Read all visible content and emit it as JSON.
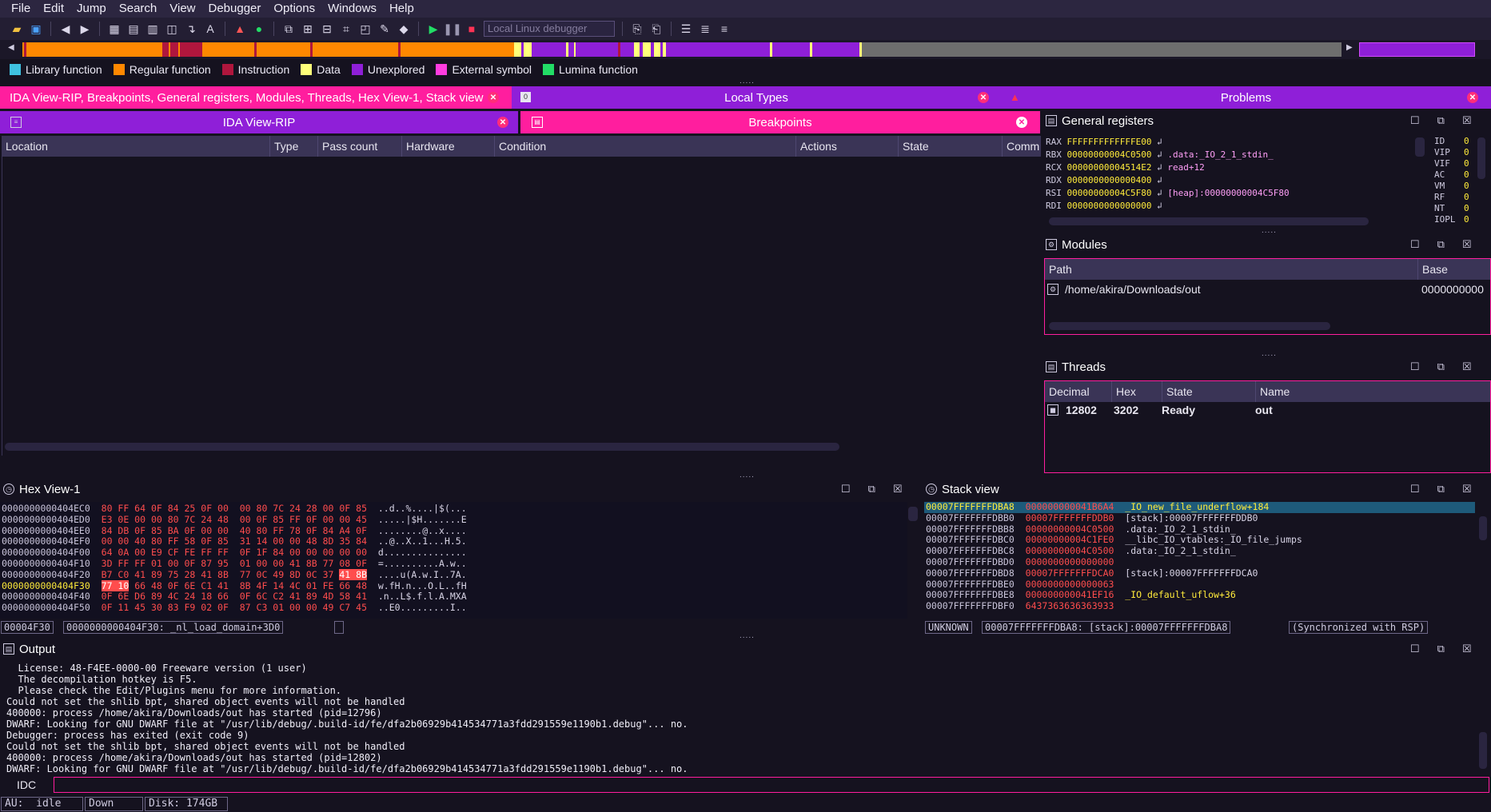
{
  "menu": [
    "File",
    "Edit",
    "Jump",
    "Search",
    "View",
    "Debugger",
    "Options",
    "Windows",
    "Help"
  ],
  "toolbar": {
    "debugger_select": "Local Linux debugger"
  },
  "legend": [
    {
      "label": "Library function",
      "color": "#3fc1e0"
    },
    {
      "label": "Regular function",
      "color": "#ff8800"
    },
    {
      "label": "Instruction",
      "color": "#b0163d"
    },
    {
      "label": "Data",
      "color": "#ffff7a"
    },
    {
      "label": "Unexplored",
      "color": "#8f1fd8"
    },
    {
      "label": "External symbol",
      "color": "#ff3ce0"
    },
    {
      "label": "Lumina function",
      "color": "#22dd66"
    }
  ],
  "top_tabs": {
    "main": "IDA View-RIP, Breakpoints, General registers, Modules, Threads, Hex View-1, Stack view",
    "local_types": "Local Types",
    "problems": "Problems"
  },
  "sub_tabs": {
    "ida_view": "IDA View-RIP",
    "breakpoints": "Breakpoints"
  },
  "breakpoints": {
    "columns": [
      "Location",
      "Type",
      "Pass count",
      "Hardware",
      "Condition",
      "Actions",
      "State",
      "Comm"
    ]
  },
  "general_registers": {
    "title": "General registers",
    "rows": [
      {
        "name": "RAX",
        "value": "FFFFFFFFFFFFFE00",
        "comment": ""
      },
      {
        "name": "RBX",
        "value": "00000000004C0500",
        "comment": ".data:_IO_2_1_stdin_"
      },
      {
        "name": "RCX",
        "value": "00000000004514E2",
        "comment": "read+12"
      },
      {
        "name": "RDX",
        "value": "0000000000000400",
        "comment": ""
      },
      {
        "name": "RSI",
        "value": "00000000004C5F80",
        "comment": "[heap]:00000000004C5F80"
      },
      {
        "name": "RDI",
        "value": "0000000000000000",
        "comment": ""
      }
    ],
    "flags": [
      {
        "name": "ID",
        "value": "0"
      },
      {
        "name": "VIP",
        "value": "0"
      },
      {
        "name": "VIF",
        "value": "0"
      },
      {
        "name": "AC",
        "value": "0"
      },
      {
        "name": "VM",
        "value": "0"
      },
      {
        "name": "RF",
        "value": "0"
      },
      {
        "name": "NT",
        "value": "0"
      },
      {
        "name": "IOPL",
        "value": "0"
      }
    ]
  },
  "modules": {
    "title": "Modules",
    "columns": [
      "Path",
      "Base"
    ],
    "rows": [
      {
        "path": "/home/akira/Downloads/out",
        "base": "0000000000"
      }
    ]
  },
  "threads": {
    "title": "Threads",
    "columns": [
      "Decimal",
      "Hex",
      "State",
      "Name"
    ],
    "rows": [
      {
        "decimal": "12802",
        "hex": "3202",
        "state": "Ready",
        "name": "out"
      }
    ]
  },
  "hex_view": {
    "title": "Hex View-1",
    "rows": [
      {
        "addr": "0000000000404EC0",
        "b1": "80 FF 64 0F 84 25 0F 00",
        "b2": "00 80 7C 24 28 00 0F 85",
        "ascii": "..d..%....|$(..."
      },
      {
        "addr": "0000000000404ED0",
        "b1": "E3 0E 00 00 80 7C 24 48",
        "b2": "00 0F 85 FF 0F 00 00 45",
        "ascii": ".....|$H.......E"
      },
      {
        "addr": "0000000000404EE0",
        "b1": "84 DB 0F 85 BA 0F 00 00",
        "b2": "40 80 FF 78 0F 84 A4 0F",
        "ascii": "........@..x...."
      },
      {
        "addr": "0000000000404EF0",
        "b1": "00 00 40 80 FF 58 0F 85",
        "b2": "31 14 00 00 48 8D 35 84",
        "ascii": "..@..X..1...H.5."
      },
      {
        "addr": "0000000000404F00",
        "b1": "64 0A 00 E9 CF FE FF FF",
        "b2": "0F 1F 84 00 00 00 00 00",
        "ascii": "d..............."
      },
      {
        "addr": "0000000000404F10",
        "b1": "3D FF FF 01 00 0F 87 95",
        "b2": "01 00 00 41 8B 77 08 0F",
        "ascii": "=..........A.w.."
      },
      {
        "addr": "0000000000404F20",
        "b1": "B7 C0 41 89 75 28 41 8B",
        "b2": "77 0C 49 8D 0C 37 41 8B",
        "ascii": "....u(A.w.I..7A."
      },
      {
        "addr": "0000000000404F30",
        "b1": "77 10 66 48 0F 6E C1 41",
        "b2": "8B 4F 14 4C 01 FE 66 48",
        "ascii": "w.fH.n...O.L..fH"
      },
      {
        "addr": "0000000000404F40",
        "b1": "0F 6E D6 89 4C 24 18 66",
        "b2": "0F 6C C2 41 89 4D 58 41",
        "ascii": ".n..L$.f.l.A.MXA"
      },
      {
        "addr": "0000000000404F50",
        "b1": "0F 11 45 30 83 F9 02 0F",
        "b2": "87 C3 01 00 00 49 C7 45",
        "ascii": "..E0.........I.."
      }
    ],
    "status_offset": "00004F30",
    "status_location": "0000000000404F30: _nl_load_domain+3D0"
  },
  "stack_view": {
    "title": "Stack view",
    "rows": [
      {
        "addr": "00007FFFFFFFDBA8",
        "val": "000000000041B6A4",
        "cmt": "_IO_new_file_underflow+184",
        "type": "sym"
      },
      {
        "addr": "00007FFFFFFFDBB0",
        "val": "00007FFFFFFFDDB0",
        "cmt": "[stack]:00007FFFFFFFDDB0",
        "type": "plain"
      },
      {
        "addr": "00007FFFFFFFDBB8",
        "val": "00000000004C0500",
        "cmt": ".data:_IO_2_1_stdin_",
        "type": "data"
      },
      {
        "addr": "00007FFFFFFFDBC0",
        "val": "00000000004C1FE0",
        "cmt": "__libc_IO_vtables:_IO_file_jumps",
        "type": "data"
      },
      {
        "addr": "00007FFFFFFFDBC8",
        "val": "00000000004C0500",
        "cmt": ".data:_IO_2_1_stdin_",
        "type": "data"
      },
      {
        "addr": "00007FFFFFFFDBD0",
        "val": "0000000000000000",
        "cmt": "",
        "type": "plain"
      },
      {
        "addr": "00007FFFFFFFDBD8",
        "val": "00007FFFFFFFDCA0",
        "cmt": "[stack]:00007FFFFFFFDCA0",
        "type": "plain"
      },
      {
        "addr": "00007FFFFFFFDBE0",
        "val": "0000000000000063",
        "cmt": "",
        "type": "plain"
      },
      {
        "addr": "00007FFFFFFFDBE8",
        "val": "000000000041EF16",
        "cmt": "_IO_default_uflow+36",
        "type": "sym"
      },
      {
        "addr": "00007FFFFFFFDBF0",
        "val": "6437363636363933",
        "cmt": "",
        "type": "plain"
      }
    ],
    "status_mode": "UNKNOWN",
    "status_location": "00007FFFFFFFDBA8: [stack]:00007FFFFFFFDBA8",
    "status_sync": "(Synchronized with RSP)"
  },
  "output": {
    "title": "Output",
    "lines": [
      "  License: 48-F4EE-0000-00 Freeware version (1 user)",
      "  The decompilation hotkey is F5.",
      "  Please check the Edit/Plugins menu for more information.",
      "Could not set the shlib bpt, shared object events will not be handled",
      "400000: process /home/akira/Downloads/out has started (pid=12796)",
      "DWARF: Looking for GNU DWARF file at \"/usr/lib/debug/.build-id/fe/dfa2b06929b414534771a3fdd291559e1190b1.debug\"... no.",
      "Debugger: process has exited (exit code 9)",
      "Could not set the shlib bpt, shared object events will not be handled",
      "400000: process /home/akira/Downloads/out has started (pid=12802)",
      "DWARF: Looking for GNU DWARF file at \"/usr/lib/debug/.build-id/fe/dfa2b06929b414534771a3fdd291559e1190b1.debug\"... no."
    ],
    "idc_label": "IDC"
  },
  "statusbar": {
    "au": "AU:  idle",
    "dir": "Down",
    "disk": "Disk: 174GB"
  }
}
